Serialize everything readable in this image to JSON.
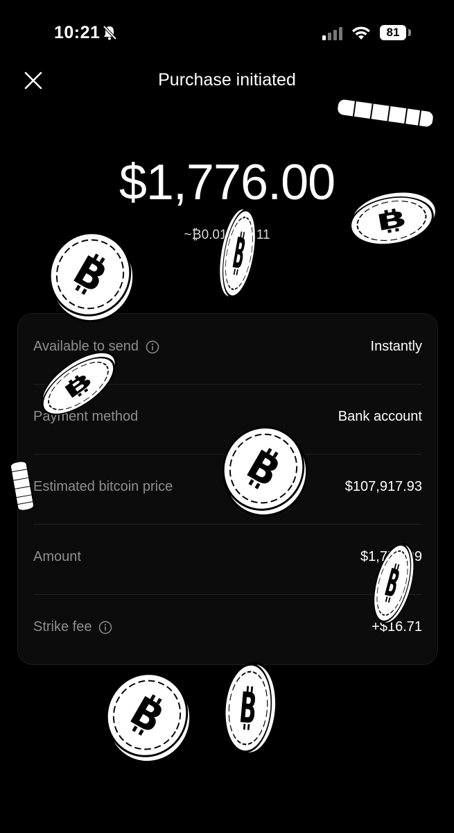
{
  "status_bar": {
    "time": "10:21",
    "battery": "81"
  },
  "header": {
    "title": "Purchase initiated"
  },
  "purchase": {
    "amount": "$1,776.00",
    "btc_amount": "~₿0.01645211"
  },
  "details": [
    {
      "label": "Available to send",
      "value": "Instantly",
      "info": true
    },
    {
      "label": "Payment method",
      "value": "Bank account",
      "info": false
    },
    {
      "label": "Estimated bitcoin price",
      "value": "$107,917.93",
      "info": false
    },
    {
      "label": "Amount",
      "value": "$1,759.29",
      "info": false
    },
    {
      "label": "Strike fee",
      "value": "+$16.71",
      "info": true
    }
  ],
  "icons": {
    "close": "close-icon",
    "info": "info-icon",
    "bell": "bell-muted-icon",
    "signal": "signal-icon",
    "wifi": "wifi-icon",
    "coin": "bitcoin-coin-icon"
  },
  "colors": {
    "background": "#000000",
    "card": "#0c0c0c",
    "label": "#8f8f8f",
    "text": "#ffffff"
  }
}
